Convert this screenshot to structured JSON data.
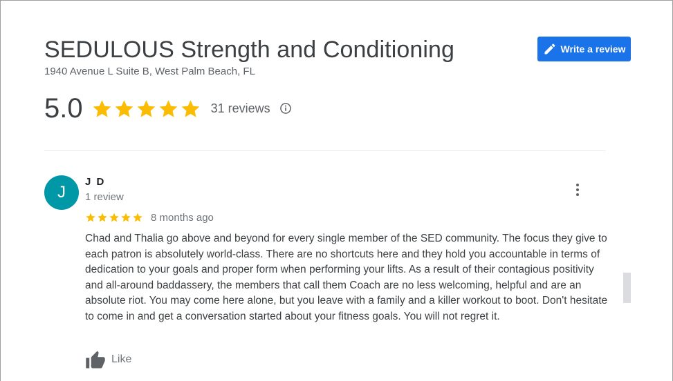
{
  "place": {
    "name": "SEDULOUS Strength and Conditioning",
    "address": "1940 Avenue L Suite B, West Palm Beach, FL"
  },
  "write_review": {
    "label": "Write a review",
    "icon": "edit-pen-icon"
  },
  "rating": {
    "value": "5.0",
    "stars": 5,
    "reviews_label": "31 reviews",
    "info_icon": "info-icon"
  },
  "review": {
    "avatar_letter": "J",
    "reviewer_name": "J D",
    "reviewer_review_count": "1 review",
    "stars": 5,
    "time_ago": "8 months ago",
    "text": "Chad and Thalia go above and beyond for every single member of the SED community. The focus they give to each patron is absolutely world-class. There are no shortcuts here and they hold you accountable in terms of dedication to your goals and proper form when performing your lifts. As a result of their contagious positivity and all-around baddassery, the members that call them Coach are no less welcoming, helpful and are an absolute riot. You may come here alone, but you leave with a family and a killer workout to boot. Don't hesitate to come in and get a conversation started about your fitness goals. You will not regret it.",
    "like_label": "Like",
    "more_icon": "more-vert-icon",
    "like_icon": "thumb-up-icon"
  },
  "colors": {
    "star": "#fbbc04",
    "button_blue": "#1a73e8",
    "avatar_bg": "#0097a7",
    "title_text": "#3c4043",
    "secondary_text": "#70757a"
  }
}
